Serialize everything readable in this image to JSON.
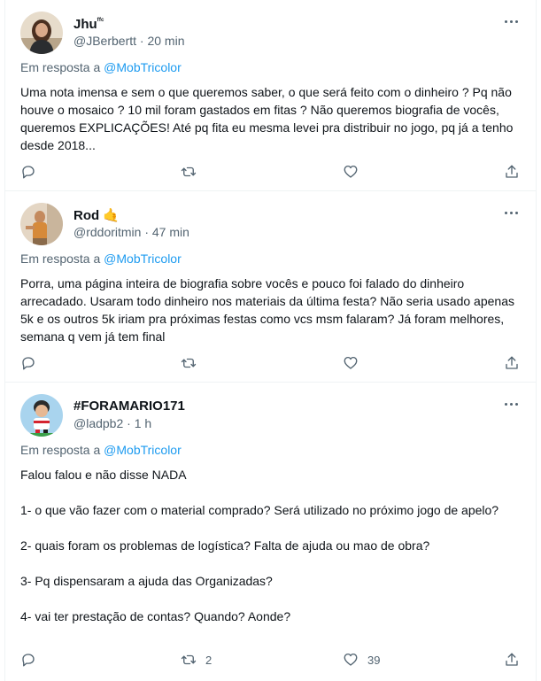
{
  "tweets": [
    {
      "name": "Jhu",
      "name_suffix": "ᶠᶠᶜ",
      "name_emoji": "",
      "handle_time": "@JBerbertt · 20 min",
      "reply_prefix": "Em resposta a",
      "reply_to": "@MobTricolor",
      "paragraphs": [
        "Uma nota imensa e sem o que queremos saber, o que será feito com o dinheiro ? Pq não houve o mosaico ? 10 mil foram gastados em fitas ? Não queremos biografia de vocês, queremos EXPLICAÇÕES! Até pq fita eu mesma levei pra distribuir no jogo, pq já a tenho desde 2018..."
      ],
      "replies": "",
      "retweets": "",
      "likes": ""
    },
    {
      "name": "Rod",
      "name_suffix": "",
      "name_emoji": "🤙",
      "handle_time": "@rddoritmin · 47 min",
      "reply_prefix": "Em resposta a",
      "reply_to": "@MobTricolor",
      "paragraphs": [
        "Porra, uma página inteira de biografia sobre vocês e pouco foi falado do dinheiro arrecadado. Usaram todo dinheiro nos materiais da última festa? Não seria usado apenas 5k e os outros 5k iriam pra próximas festas como vcs msm falaram? Já foram melhores, semana q vem já tem final"
      ],
      "replies": "",
      "retweets": "",
      "likes": ""
    },
    {
      "name": "#FORAMARIO171",
      "name_suffix": "",
      "name_emoji": "",
      "handle_time": "@ladpb2 · 1 h",
      "reply_prefix": "Em resposta a",
      "reply_to": "@MobTricolor",
      "paragraphs": [
        "Falou falou e não disse NADA",
        "1- o que vão fazer com o material comprado? Será utilizado no próximo jogo de apelo?",
        "2- quais foram os problemas de logística? Falta de ajuda ou mao de obra?",
        "3- Pq dispensaram a ajuda das Organizadas?",
        "4- vai ter prestação de contas? Quando? Aonde?"
      ],
      "replies": "",
      "retweets": "2",
      "likes": "39"
    }
  ],
  "icons": {
    "reply": "reply-icon",
    "retweet": "retweet-icon",
    "like": "heart-icon",
    "share": "share-icon",
    "more": "more-icon"
  },
  "colors": {
    "text": "#0f1419",
    "secondary": "#536471",
    "link": "#1d9bf0",
    "divider": "#eff3f4"
  }
}
